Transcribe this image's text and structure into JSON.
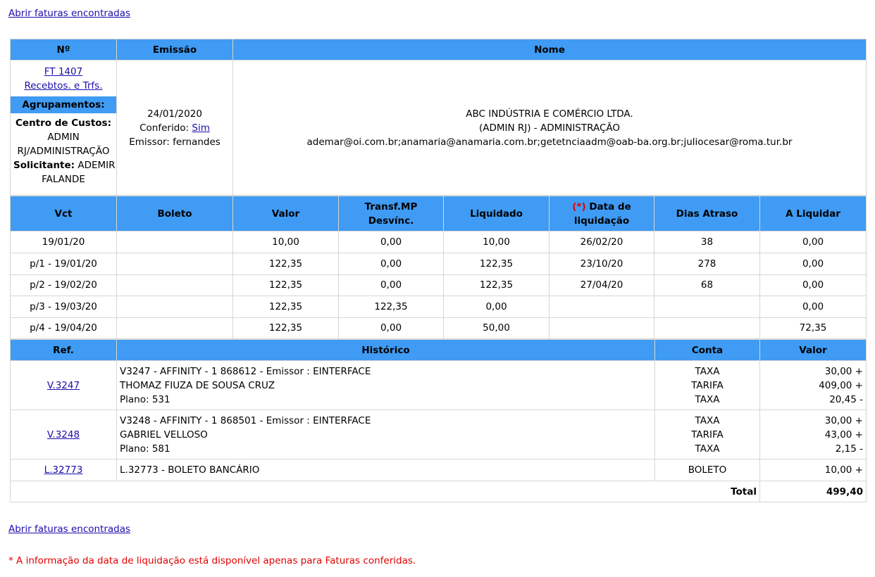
{
  "links": {
    "open_top": "Abrir faturas encontradas",
    "open_bottom": "Abrir faturas encontradas"
  },
  "header_table": {
    "col_no": "Nº",
    "col_emissao": "Emissão",
    "col_nome": "Nome"
  },
  "invoice": {
    "number": "FT 1407",
    "receipts_link": "Recebtos. e Trfs.",
    "grouping_title": "Agrupamentos:",
    "cost_center_label": "Centro de Custos:",
    "cost_center_value_1": "ADMIN",
    "cost_center_value_2": "RJ/ADMINISTRAÇÃO",
    "requester_label": "Solicitante:",
    "requester_value_1": "ADEMIR",
    "requester_value_2": "FALANDE",
    "date": "24/01/2020",
    "checked_label": "Conferido:",
    "checked_value": "Sim",
    "issuer": "Emissor: fernandes",
    "name_1": "ABC INDÚSTRIA E COMÉRCIO LTDA.",
    "name_2": "(ADMIN RJ) - ADMINISTRAÇÃO",
    "emails": "ademar@oi.com.br;anamaria@anamaria.com.br;getetnciaadm@oab-ba.org.br;juliocesar@roma.tur.br"
  },
  "installments": {
    "headers": {
      "vct": "Vct",
      "boleto": "Boleto",
      "valor": "Valor",
      "transf_1": "Transf.MP",
      "transf_2": "Desvínc.",
      "liquidado": "Liquidado",
      "asterisk": "(*)",
      "data_1": "Data de",
      "data_2": "liquidação",
      "dias": "Dias Atraso",
      "a_liquidar": "A Liquidar"
    },
    "rows": [
      {
        "vct": "19/01/20",
        "boleto": "",
        "valor": "10,00",
        "transf": "0,00",
        "liquidado": "10,00",
        "data": "26/02/20",
        "dias": "38",
        "a_liquidar": "0,00"
      },
      {
        "vct": "p/1 - 19/01/20",
        "boleto": "",
        "valor": "122,35",
        "transf": "0,00",
        "liquidado": "122,35",
        "data": "23/10/20",
        "dias": "278",
        "a_liquidar": "0,00"
      },
      {
        "vct": "p/2 - 19/02/20",
        "boleto": "",
        "valor": "122,35",
        "transf": "0,00",
        "liquidado": "122,35",
        "data": "27/04/20",
        "dias": "68",
        "a_liquidar": "0,00"
      },
      {
        "vct": "p/3 - 19/03/20",
        "boleto": "",
        "valor": "122,35",
        "transf": "122,35",
        "liquidado": "0,00",
        "data": "",
        "dias": "",
        "a_liquidar": "0,00"
      },
      {
        "vct": "p/4 - 19/04/20",
        "boleto": "",
        "valor": "122,35",
        "transf": "0,00",
        "liquidado": "50,00",
        "data": "",
        "dias": "",
        "a_liquidar": "72,35"
      }
    ]
  },
  "history": {
    "headers": {
      "ref": "Ref.",
      "historico": "Histórico",
      "conta": "Conta",
      "valor": "Valor"
    },
    "entries": [
      {
        "ref": "V.3247",
        "lines": [
          "V3247 - AFFINITY - 1 868612 - Emissor : EINTERFACE",
          "THOMAZ FIUZA DE SOUSA CRUZ",
          "Plano: 531"
        ],
        "contas": [
          "TAXA",
          "TARIFA",
          "TAXA"
        ],
        "valores": [
          "30,00 +",
          "409,00 +",
          "20,45 -"
        ]
      },
      {
        "ref": "V.3248",
        "lines": [
          "V3248 - AFFINITY - 1 868501 - Emissor : EINTERFACE",
          "GABRIEL VELLOSO",
          "Plano: 581"
        ],
        "contas": [
          "TAXA",
          "TARIFA",
          "TAXA"
        ],
        "valores": [
          "30,00 +",
          "43,00 +",
          "2,15 -"
        ]
      },
      {
        "ref": "L.32773",
        "lines": [
          "L.32773 - BOLETO BANCÁRIO"
        ],
        "contas": [
          "BOLETO"
        ],
        "valores": [
          "10,00 +"
        ]
      }
    ],
    "total_label": "Total",
    "total_value": "499,40"
  },
  "footnote": "* A informação da data de liquidação está disponível apenas para Faturas conferidas.",
  "colors": {
    "header_bg": "#3f9bf3",
    "link": "#1a0dab",
    "note": "#e00000",
    "border": "#d6d6d6"
  }
}
